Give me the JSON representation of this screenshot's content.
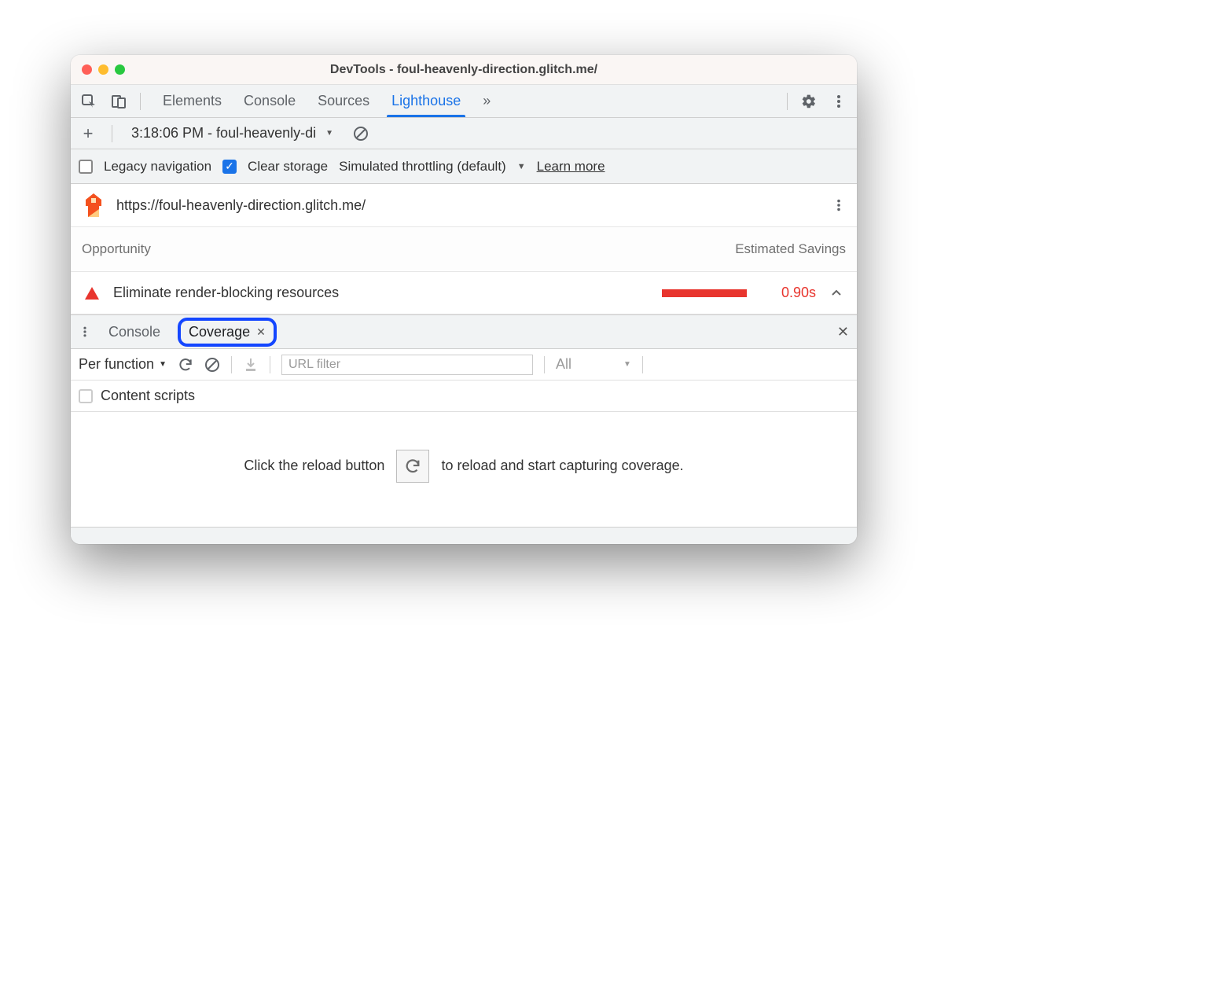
{
  "window": {
    "title": "DevTools - foul-heavenly-direction.glitch.me/"
  },
  "tabs": {
    "items": [
      "Elements",
      "Console",
      "Sources",
      "Lighthouse"
    ],
    "active": "Lighthouse"
  },
  "lighthouse_bar": {
    "report_label": "3:18:06 PM - foul-heavenly-di"
  },
  "options": {
    "legacy_label": "Legacy navigation",
    "clear_label": "Clear storage",
    "throttling_label": "Simulated throttling (default)",
    "learn_more": "Learn more"
  },
  "report": {
    "url": "https://foul-heavenly-direction.glitch.me/",
    "columns": {
      "left": "Opportunity",
      "right": "Estimated Savings"
    },
    "opportunity": {
      "title": "Eliminate render-blocking resources",
      "savings": "0.90s"
    }
  },
  "drawer": {
    "tabs": {
      "console": "Console",
      "coverage": "Coverage"
    },
    "toolbar": {
      "granularity": "Per function",
      "filter_placeholder": "URL filter",
      "type_filter": "All",
      "content_scripts": "Content scripts"
    },
    "message": {
      "pre": "Click the reload button",
      "post": "to reload and start capturing coverage."
    }
  }
}
